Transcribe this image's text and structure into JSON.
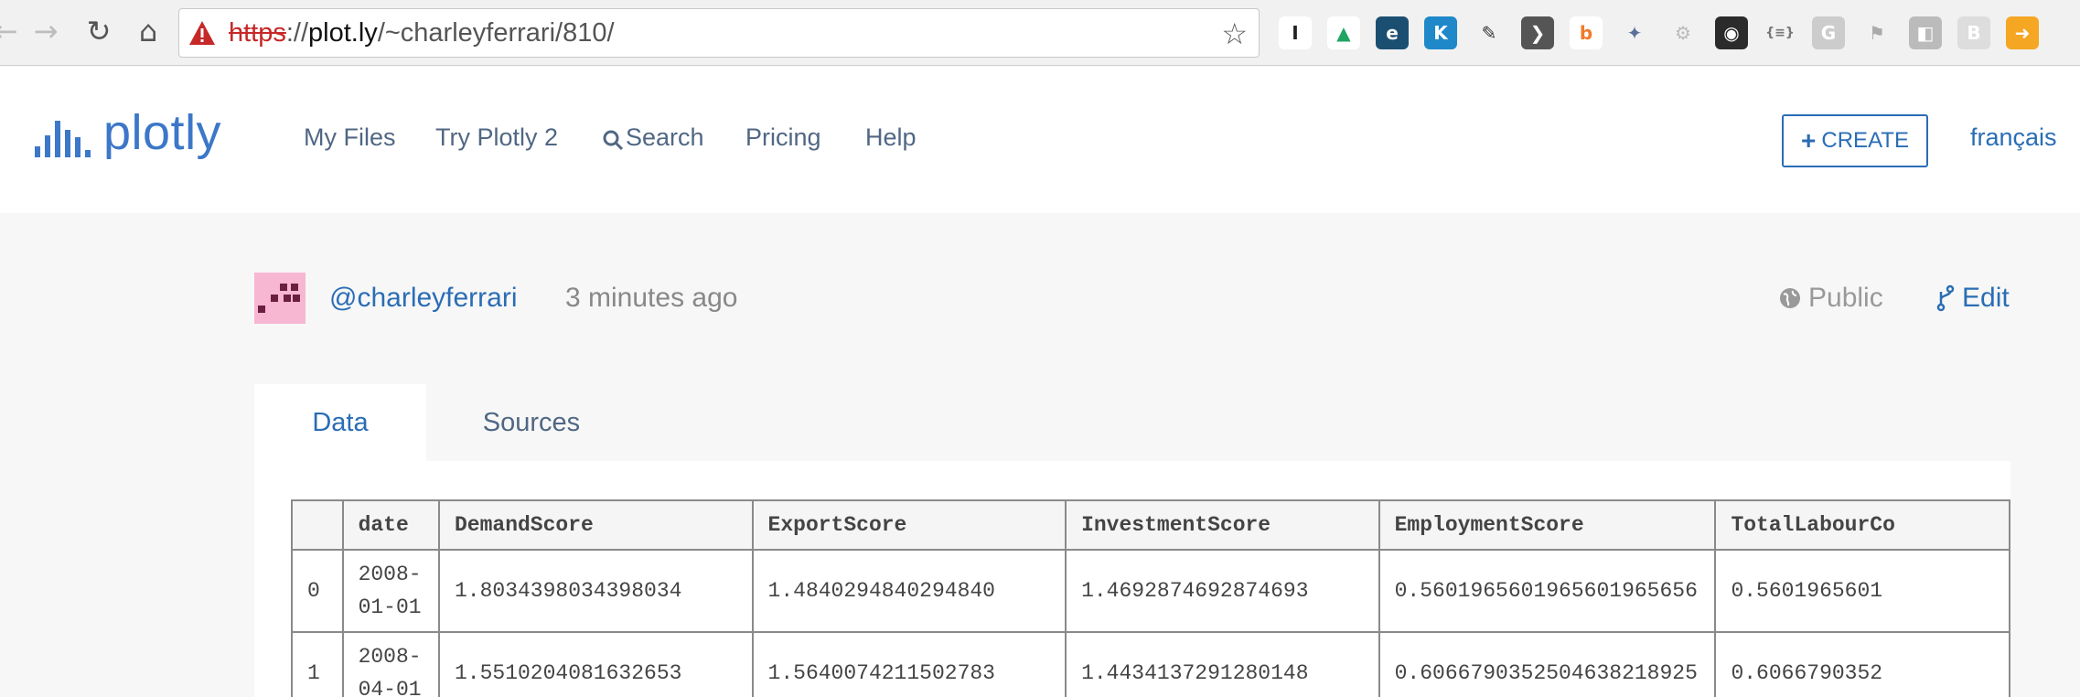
{
  "browser": {
    "url_scheme": "https",
    "url_host": "plot.ly",
    "url_path": "/~charleyferrari/810/",
    "extensions": [
      {
        "name": "instapaper-icon",
        "glyph": "I",
        "color": "#ffffff",
        "fg": "#222222"
      },
      {
        "name": "google-drive-icon",
        "glyph": "▲",
        "color": "#ffffff",
        "fg": "#1fa463"
      },
      {
        "name": "extension-e-icon",
        "glyph": "e",
        "color": "#1b4f72",
        "fg": "#ffffff"
      },
      {
        "name": "klout-icon",
        "glyph": "K",
        "color": "#1e88c9",
        "fg": "#ffffff"
      },
      {
        "name": "evernote-icon",
        "glyph": "✎",
        "color": "#f1f1f1",
        "fg": "#333333"
      },
      {
        "name": "pocket-icon",
        "glyph": "❯",
        "color": "#555555",
        "fg": "#ffffff"
      },
      {
        "name": "extension-b-icon",
        "glyph": "b",
        "color": "#ffffff",
        "fg": "#f07a2a"
      },
      {
        "name": "satellite-icon",
        "glyph": "✦",
        "color": "#f1f1f1",
        "fg": "#5a6f9a"
      },
      {
        "name": "gear-extension-icon",
        "glyph": "⚙",
        "color": "#f1f1f1",
        "fg": "#bbbbbb"
      },
      {
        "name": "glasses-icon",
        "glyph": "◉",
        "color": "#2b2b2b",
        "fg": "#ffffff"
      },
      {
        "name": "json-icon",
        "glyph": "{≡}",
        "color": "#f1f1f1",
        "fg": "#777777"
      },
      {
        "name": "extension-g-icon",
        "glyph": "G",
        "color": "#cccccc",
        "fg": "#ffffff"
      },
      {
        "name": "extension-flag-icon",
        "glyph": "⚑",
        "color": "#f1f1f1",
        "fg": "#aaaaaa"
      },
      {
        "name": "extension-grey-icon",
        "glyph": "◧",
        "color": "#bbbbbb",
        "fg": "#ffffff"
      },
      {
        "name": "extension-bi-icon",
        "glyph": "B",
        "color": "#dddddd",
        "fg": "#ffffff"
      },
      {
        "name": "extension-arrow-icon",
        "glyph": "➜",
        "color": "#f5a623",
        "fg": "#ffffff"
      }
    ]
  },
  "header": {
    "logo_text": "plotly",
    "nav": [
      "My Files",
      "Try Plotly 2",
      "Search",
      "Pricing",
      "Help"
    ],
    "create_label": "CREATE",
    "language": "français"
  },
  "meta": {
    "author": "@charleyferrari",
    "time_ago": "3 minutes ago",
    "visibility": "Public",
    "edit": "Edit"
  },
  "tabs": {
    "data": "Data",
    "sources": "Sources"
  },
  "grid": {
    "columns": [
      "",
      "date",
      "DemandScore",
      "ExportScore",
      "InvestmentScore",
      "EmploymentScore",
      "TotalLabourCo"
    ],
    "rows": [
      [
        "0",
        "2008-01-01",
        "1.8034398034398034",
        "1.4840294840294840",
        "1.4692874692874693",
        "0.5601965601965601965656",
        "0.5601965601"
      ],
      [
        "1",
        "2008-04-01",
        "1.5510204081632653",
        "1.5640074211502783",
        "1.4434137291280148",
        "0.6066790352504638218925",
        "0.6066790352"
      ]
    ]
  },
  "colors": {
    "accent": "#2a6db5",
    "nav_text": "#506784",
    "avatar_bg": "#f7b6d2"
  }
}
